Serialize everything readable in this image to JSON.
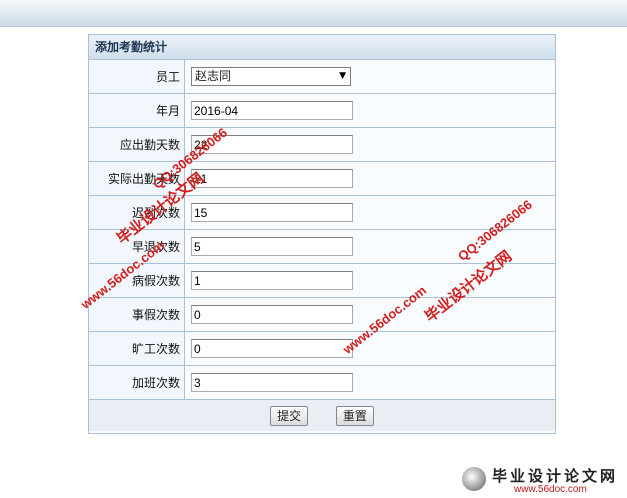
{
  "panel": {
    "title": "添加考勤统计"
  },
  "form": {
    "employee": {
      "label": "员工",
      "value": "赵志同"
    },
    "month": {
      "label": "年月",
      "value": "2016-04"
    },
    "required_days": {
      "label": "应出勤天数",
      "value": "22"
    },
    "actual_days": {
      "label": "实际出勤天数",
      "value": "21"
    },
    "late_count": {
      "label": "迟到次数",
      "value": "15"
    },
    "early_leave_count": {
      "label": "早退次数",
      "value": "5"
    },
    "sick_leave_count": {
      "label": "病假次数",
      "value": "1"
    },
    "personal_leave_count": {
      "label": "事假次数",
      "value": "0"
    },
    "absence_count": {
      "label": "旷工次数",
      "value": "0"
    },
    "overtime_count": {
      "label": "加班次数",
      "value": "3"
    }
  },
  "buttons": {
    "submit": "提交",
    "reset": "重置"
  },
  "watermark": {
    "site_name": "毕业设计论文网",
    "url": "www.56doc.com",
    "qq": "QQ:306826066"
  },
  "logo": {
    "title": "毕业设计论文网",
    "url": "www.56doc.com"
  }
}
